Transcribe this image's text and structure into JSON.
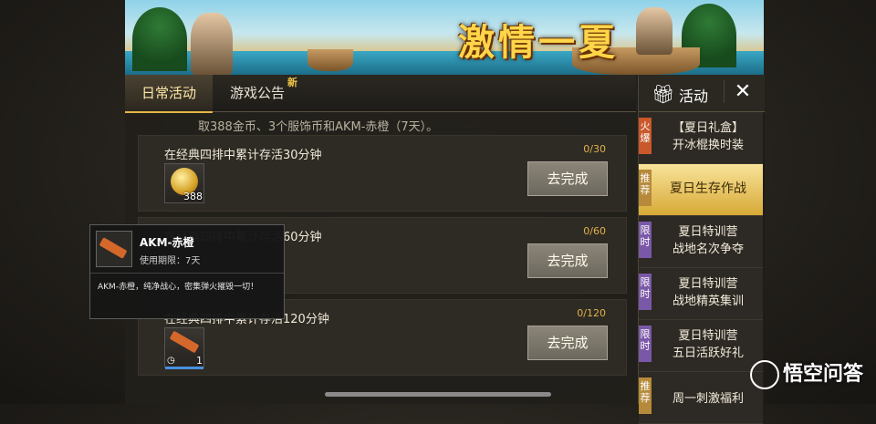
{
  "banner": {
    "title": "激情一夏"
  },
  "tabs": [
    {
      "label": "日常活动",
      "active": true
    },
    {
      "label": "游戏公告",
      "badge": "新"
    }
  ],
  "description": "取388金币、3个服饰币和AKM-赤橙（7天）。",
  "tasks": [
    {
      "title": "在经典四排中累计存活30分钟",
      "progress": "0/30",
      "button": "去完成",
      "reward": {
        "icon": "gold-coin-icon",
        "qty": "388"
      }
    },
    {
      "title": "在经典四排中累计存活60分钟",
      "progress": "0/60",
      "button": "去完成"
    },
    {
      "title": "在经典四排中累计存活120分钟",
      "progress": "0/120",
      "button": "去完成",
      "reward": {
        "icon": "akm-rifle-icon",
        "qty": "1"
      }
    }
  ],
  "sidebar": {
    "header": {
      "icon": "gift-icon",
      "label": "活动",
      "close": "✕"
    },
    "items": [
      {
        "tag": "火爆",
        "tag_type": "hot",
        "line1": "【夏日礼盒】",
        "line2": "开冰棍换时装"
      },
      {
        "tag": "推荐",
        "tag_type": "rec",
        "line1": "夏日生存作战",
        "line2": "",
        "active": true
      },
      {
        "tag": "限时",
        "tag_type": "lim",
        "line1": "夏日特训营",
        "line2": "战地名次争夺"
      },
      {
        "tag": "限时",
        "tag_type": "lim",
        "line1": "夏日特训营",
        "line2": "战地精英集训"
      },
      {
        "tag": "限时",
        "tag_type": "lim",
        "line1": "夏日特训营",
        "line2": "五日活跃好礼"
      },
      {
        "tag": "推荐",
        "tag_type": "rec",
        "line1": "周一刺激福利",
        "line2": ""
      }
    ]
  },
  "tooltip": {
    "name": "AKM-赤橙",
    "validity": "使用期限：7天",
    "description": "AKM-赤橙，纯净战心，密集弹火摧毁一切！"
  },
  "watermark": "悟空问答",
  "colors": {
    "accent": "#e2b844",
    "button": "#7b766b",
    "active_item": "#f0d06a"
  }
}
